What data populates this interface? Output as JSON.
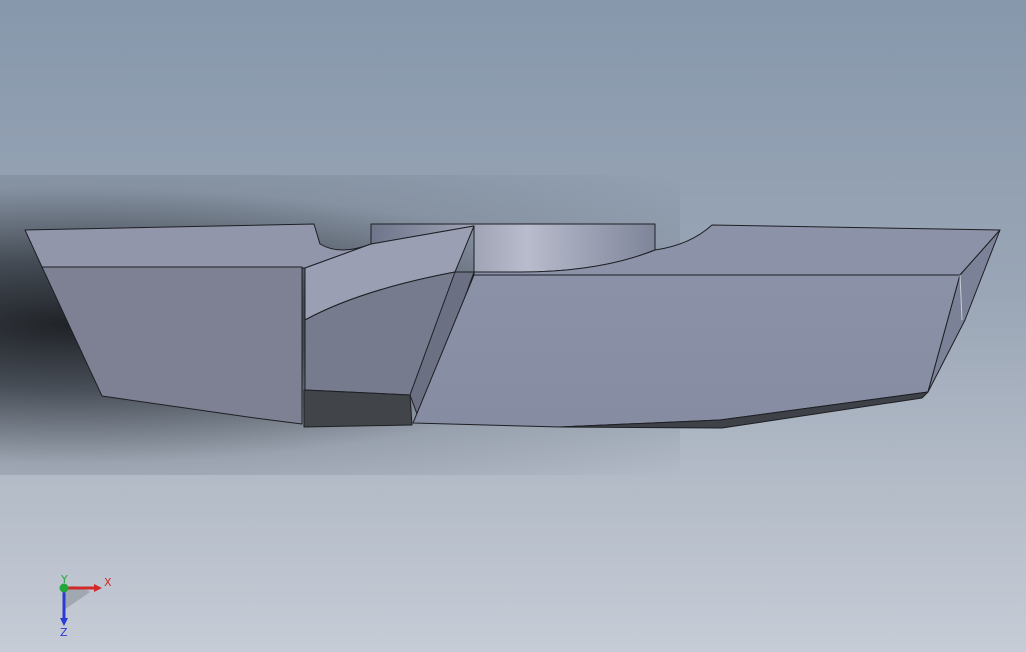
{
  "viewport": {
    "background_top": "#8798ac",
    "background_bottom": "#c6ccd6"
  },
  "model": {
    "face_color_light": "#8a90a6",
    "face_color_mid": "#7d8398",
    "face_color_dark": "#3f4249",
    "edge_color": "#1e1f24"
  },
  "triad": {
    "x_label": "X",
    "y_label": "Y",
    "z_label": "Z",
    "x_color": "#d22a2a",
    "y_color": "#22a83a",
    "z_color": "#2a3ad2"
  }
}
